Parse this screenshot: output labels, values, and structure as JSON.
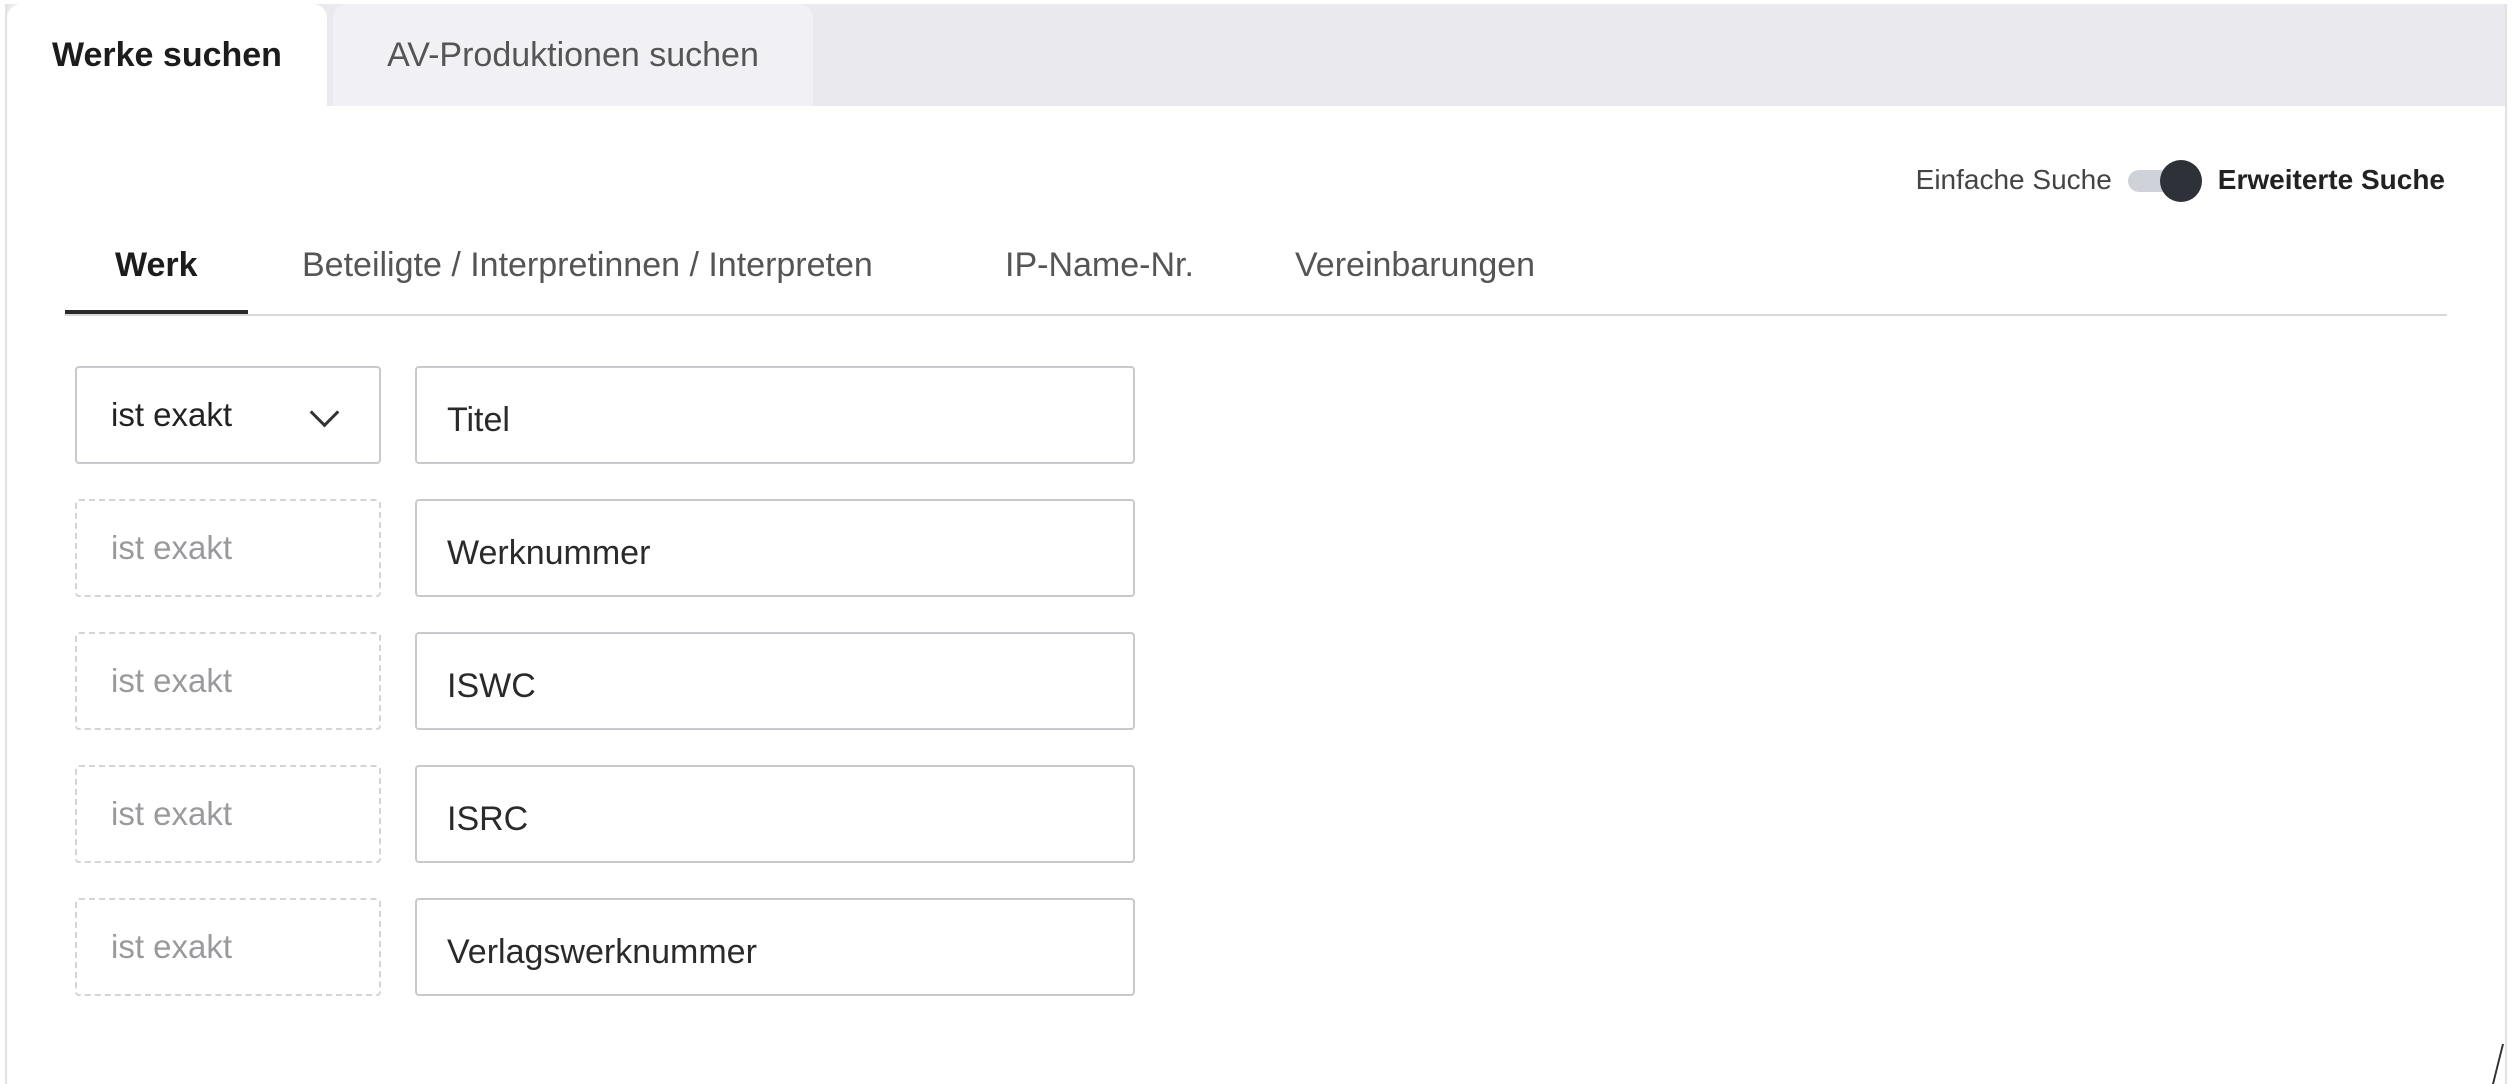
{
  "top_tabs": [
    {
      "label": "Werke suchen",
      "active": true
    },
    {
      "label": "AV-Produktionen suchen",
      "active": false
    }
  ],
  "mode_toggle": {
    "left_label": "Einfache Suche",
    "right_label": "Erweiterte Suche",
    "state": "Erweiterte Suche"
  },
  "sub_tabs": [
    {
      "label": "Werk",
      "active": true
    },
    {
      "label": "Beteiligte / Interpretinnen / Interpreten",
      "active": false
    },
    {
      "label": "IP-Name-Nr.",
      "active": false
    },
    {
      "label": "Vereinbarungen",
      "active": false
    }
  ],
  "search_rows": [
    {
      "operator": "ist exakt",
      "operator_enabled": true,
      "placeholder": "Titel"
    },
    {
      "operator": "ist exakt",
      "operator_enabled": false,
      "placeholder": "Werknummer"
    },
    {
      "operator": "ist exakt",
      "operator_enabled": false,
      "placeholder": "ISWC"
    },
    {
      "operator": "ist exakt",
      "operator_enabled": false,
      "placeholder": "ISRC"
    },
    {
      "operator": "ist exakt",
      "operator_enabled": false,
      "placeholder": "Verlagswerknummer"
    }
  ],
  "colors": {
    "tab_bar_bg": "#e9e9ee",
    "toggle_knob": "#2f3138",
    "border": "#c9c9cd"
  }
}
